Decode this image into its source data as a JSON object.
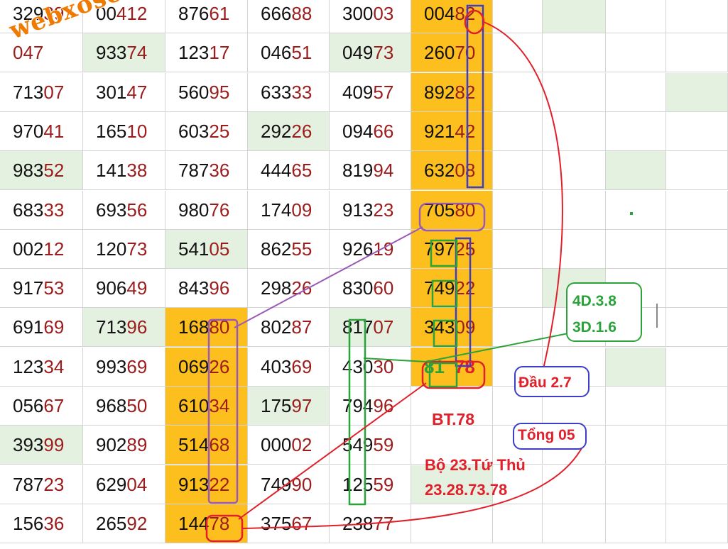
{
  "watermark": "webxoso.net",
  "rows": [
    {
      "cells": [
        [
          "329",
          "39"
        ],
        [
          "00",
          "412"
        ],
        [
          "876",
          "61"
        ],
        [
          "666",
          "88"
        ],
        [
          "300",
          "03"
        ],
        [
          "004",
          "82"
        ]
      ]
    },
    {
      "cells": [
        [
          "",
          "047"
        ],
        [
          "933",
          "74"
        ],
        [
          "123",
          "17"
        ],
        [
          "046",
          "51"
        ],
        [
          "049",
          "73"
        ],
        [
          "260",
          "70"
        ]
      ]
    },
    {
      "cells": [
        [
          "713",
          "07"
        ],
        [
          "301",
          "47"
        ],
        [
          "560",
          "95"
        ],
        [
          "633",
          "33"
        ],
        [
          "409",
          "57"
        ],
        [
          "892",
          "82"
        ]
      ]
    },
    {
      "cells": [
        [
          "970",
          "41"
        ],
        [
          "165",
          "10"
        ],
        [
          "603",
          "25"
        ],
        [
          "292",
          "26"
        ],
        [
          "094",
          "66"
        ],
        [
          "921",
          "42"
        ]
      ]
    },
    {
      "cells": [
        [
          "983",
          "52"
        ],
        [
          "141",
          "38"
        ],
        [
          "787",
          "36"
        ],
        [
          "444",
          "65"
        ],
        [
          "819",
          "94"
        ],
        [
          "632",
          "08"
        ]
      ]
    },
    {
      "cells": [
        [
          "683",
          "33"
        ],
        [
          "693",
          "56"
        ],
        [
          "980",
          "76"
        ],
        [
          "174",
          "09"
        ],
        [
          "913",
          "23"
        ],
        [
          "705",
          "80"
        ]
      ]
    },
    {
      "cells": [
        [
          "002",
          "12"
        ],
        [
          "120",
          "73"
        ],
        [
          "541",
          "05"
        ],
        [
          "862",
          "55"
        ],
        [
          "926",
          "19"
        ],
        [
          "797",
          "25"
        ]
      ]
    },
    {
      "cells": [
        [
          "917",
          "53"
        ],
        [
          "906",
          "49"
        ],
        [
          "843",
          "96"
        ],
        [
          "298",
          "26"
        ],
        [
          "830",
          "60"
        ],
        [
          "749",
          "22"
        ]
      ]
    },
    {
      "cells": [
        [
          "691",
          "69"
        ],
        [
          "713",
          "96"
        ],
        [
          "168",
          "80"
        ],
        [
          "802",
          "87"
        ],
        [
          "817",
          "07"
        ],
        [
          "343",
          "09"
        ]
      ]
    },
    {
      "cells": [
        [
          "123",
          "34"
        ],
        [
          "993",
          "69"
        ],
        [
          "069",
          "26"
        ],
        [
          "403",
          "69"
        ],
        [
          "430",
          "30"
        ],
        [
          "81",
          "78"
        ]
      ]
    },
    {
      "cells": [
        [
          "056",
          "67"
        ],
        [
          "968",
          "50"
        ],
        [
          "610",
          "34"
        ],
        [
          "175",
          "97"
        ],
        [
          "794",
          "96"
        ],
        [
          "",
          ""
        ]
      ]
    },
    {
      "cells": [
        [
          "393",
          "99"
        ],
        [
          "902",
          "89"
        ],
        [
          "514",
          "68"
        ],
        [
          "000",
          "02"
        ],
        [
          "549",
          "59"
        ],
        [
          "",
          ""
        ]
      ]
    },
    {
      "cells": [
        [
          "787",
          "23"
        ],
        [
          "629",
          "04"
        ],
        [
          "913",
          "22"
        ],
        [
          "749",
          "90"
        ],
        [
          "125",
          "59"
        ],
        [
          "",
          ""
        ]
      ]
    },
    {
      "cells": [
        [
          "156",
          "36"
        ],
        [
          "265",
          "92"
        ],
        [
          "144",
          "78"
        ],
        [
          "375",
          "67"
        ],
        [
          "238",
          "77"
        ],
        [
          "",
          ""
        ]
      ]
    }
  ],
  "annotations": {
    "box_4d": "4D.3.8",
    "box_3d": "3D.1.6",
    "dau": "Đầu 2.7",
    "bt": "BT.78",
    "tong": "Tổng 05",
    "bo_line1": "Bộ 23.Tứ Thủ",
    "bo_line2": "23.28.73.78"
  },
  "colors": {
    "highlight_orange": "#fcbf1e",
    "light_green": "#e4f1e0",
    "digit_red": "#9c1b1b",
    "annotation_red": "#e0202a",
    "annotation_green": "#2aa33a",
    "line_purple": "#9b59b6",
    "line_blue": "#3d3dc8"
  }
}
